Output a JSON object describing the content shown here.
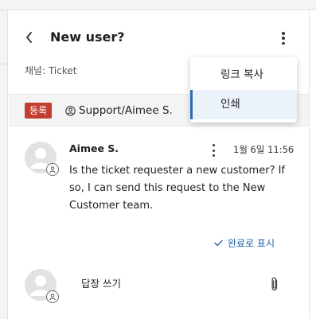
{
  "header": {
    "title": "New user?"
  },
  "channel": {
    "text": "채널: Ticket"
  },
  "ticket": {
    "status_badge": "등록",
    "assignee": "Support/Aimee S."
  },
  "message": {
    "author": "Aimee S.",
    "timestamp": "1월 6일 11:56",
    "body": "Is the ticket requester a new customer? If so, I can send this request to the New Customer team."
  },
  "actions": {
    "mark_done_label": "완료로 표시"
  },
  "reply": {
    "placeholder": "답장 쓰기"
  },
  "menu": {
    "items": [
      {
        "label": "링크 복사"
      },
      {
        "label": "인쇄"
      }
    ]
  },
  "colors": {
    "badge": "#c43d31",
    "link": "#1f5fa6",
    "menu_highlight": "#ebf2fa",
    "menu_accent": "#2b6cb0"
  },
  "icons": {
    "back": "chevron-left-icon",
    "more": "kebab-icon",
    "assignee": "user-circle-icon",
    "check": "check-icon",
    "attach": "paperclip-icon"
  }
}
